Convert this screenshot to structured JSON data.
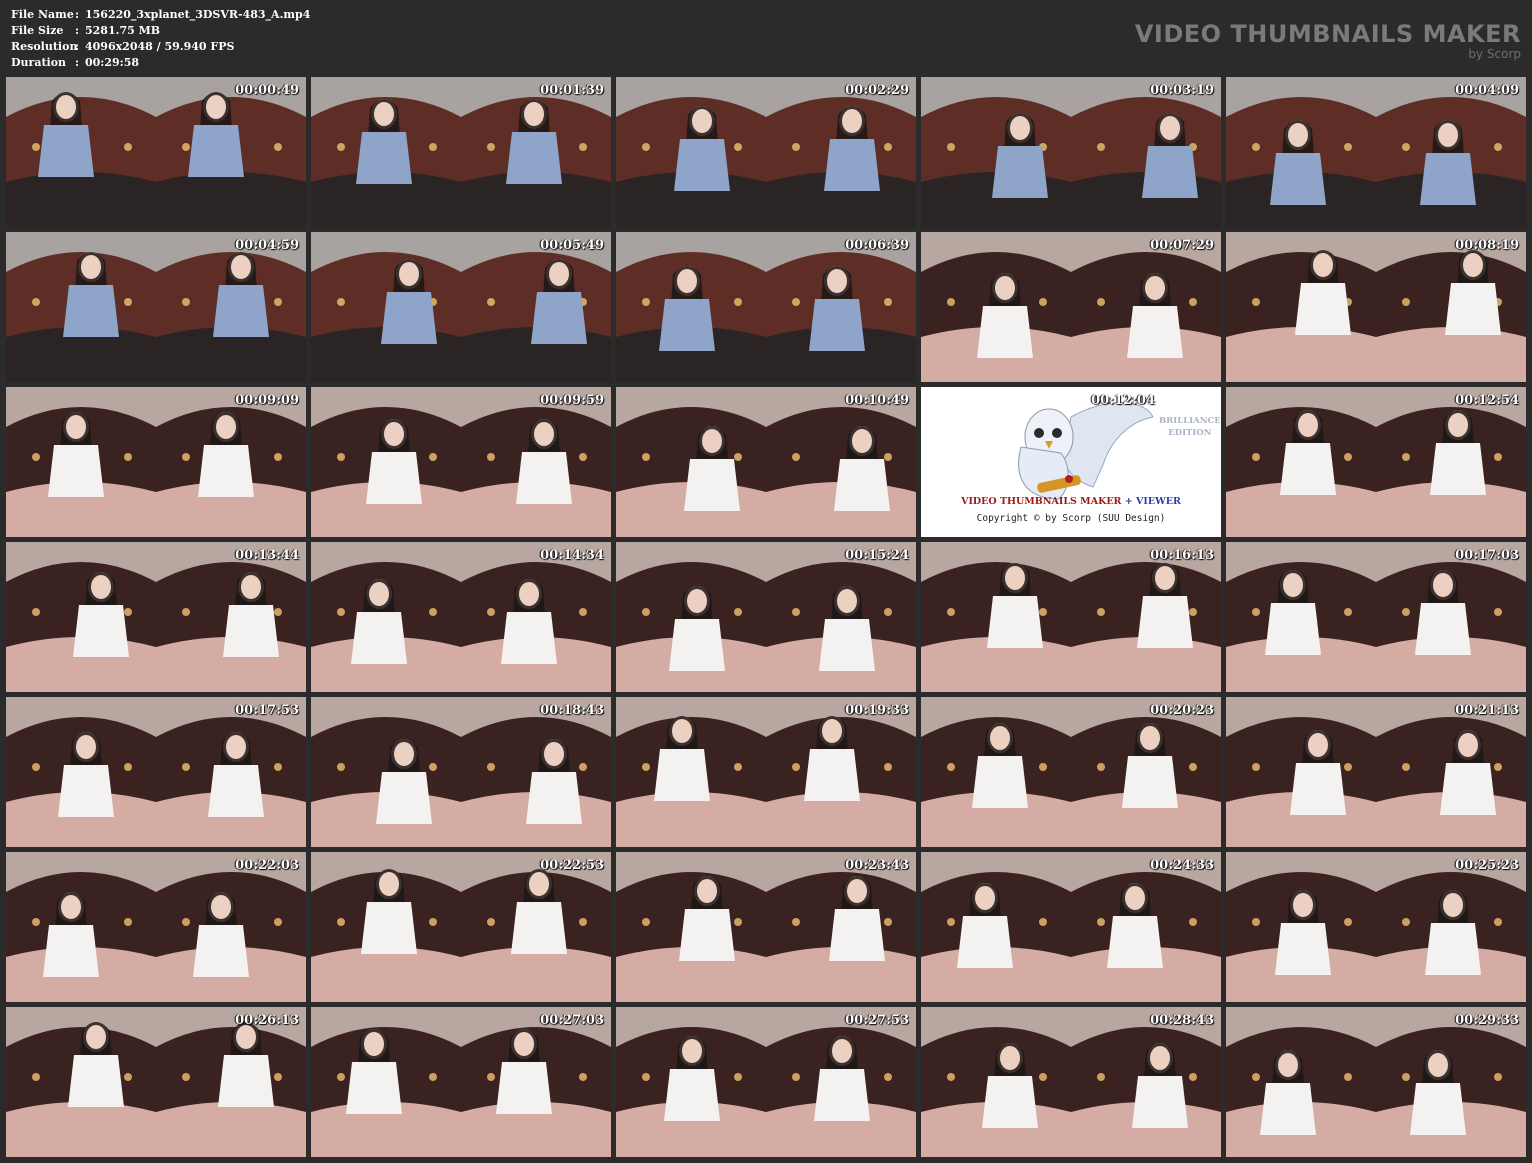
{
  "info": {
    "file_name_label": "File Name",
    "file_name": "156220_3xplanet_3DSVR-483_A.mp4",
    "file_size_label": "File Size",
    "file_size": "5281.75 MB",
    "resolution_label": "Resolution",
    "resolution": "4096x2048 / 59.940 FPS",
    "duration_label": "Duration",
    "duration": "00:29:58",
    "separator": ":"
  },
  "brand": {
    "title": "VIDEO THUMBNAILS MAKER",
    "subtitle": "by Scorp"
  },
  "logo_tile": {
    "part1": "VIDEO THUMBNAILS MAKER",
    "part2": " + VIEWER",
    "copyright": "Copyright © by Scorp (SUU Design)",
    "edition_line1": "BRILLIANCE",
    "edition_line2": "EDITION",
    "colors": {
      "part1": "#a01818",
      "part2": "#2840a8"
    }
  },
  "thumbnails": [
    "00:00:49",
    "00:01:39",
    "00:02:29",
    "00:03:19",
    "00:04:09",
    "00:04:59",
    "00:05:49",
    "00:06:39",
    "00:07:29",
    "00:08:19",
    "00:09:09",
    "00:09:59",
    "00:10:49",
    "00:12:04",
    "00:12:54",
    "00:13:44",
    "00:14:34",
    "00:15:24",
    "00:16:13",
    "00:17:03",
    "00:17:53",
    "00:18:43",
    "00:19:33",
    "00:20:23",
    "00:21:13",
    "00:22:03",
    "00:22:53",
    "00:23:43",
    "00:24:33",
    "00:25:23",
    "00:26:13",
    "00:27:03",
    "00:27:53",
    "00:28:43",
    "00:29:33"
  ],
  "logo_index": 13,
  "scene_colors": {
    "scene_a": {
      "ceiling": "#a8a2a0",
      "wall": "#5e2e26",
      "floor": "#2a2424",
      "figure": "#8ea4c8"
    },
    "scene_b": {
      "ceiling": "#b8a6a0",
      "wall": "#3a2220",
      "floor": "#d4aca4",
      "figure": "#f4f2f0"
    }
  }
}
